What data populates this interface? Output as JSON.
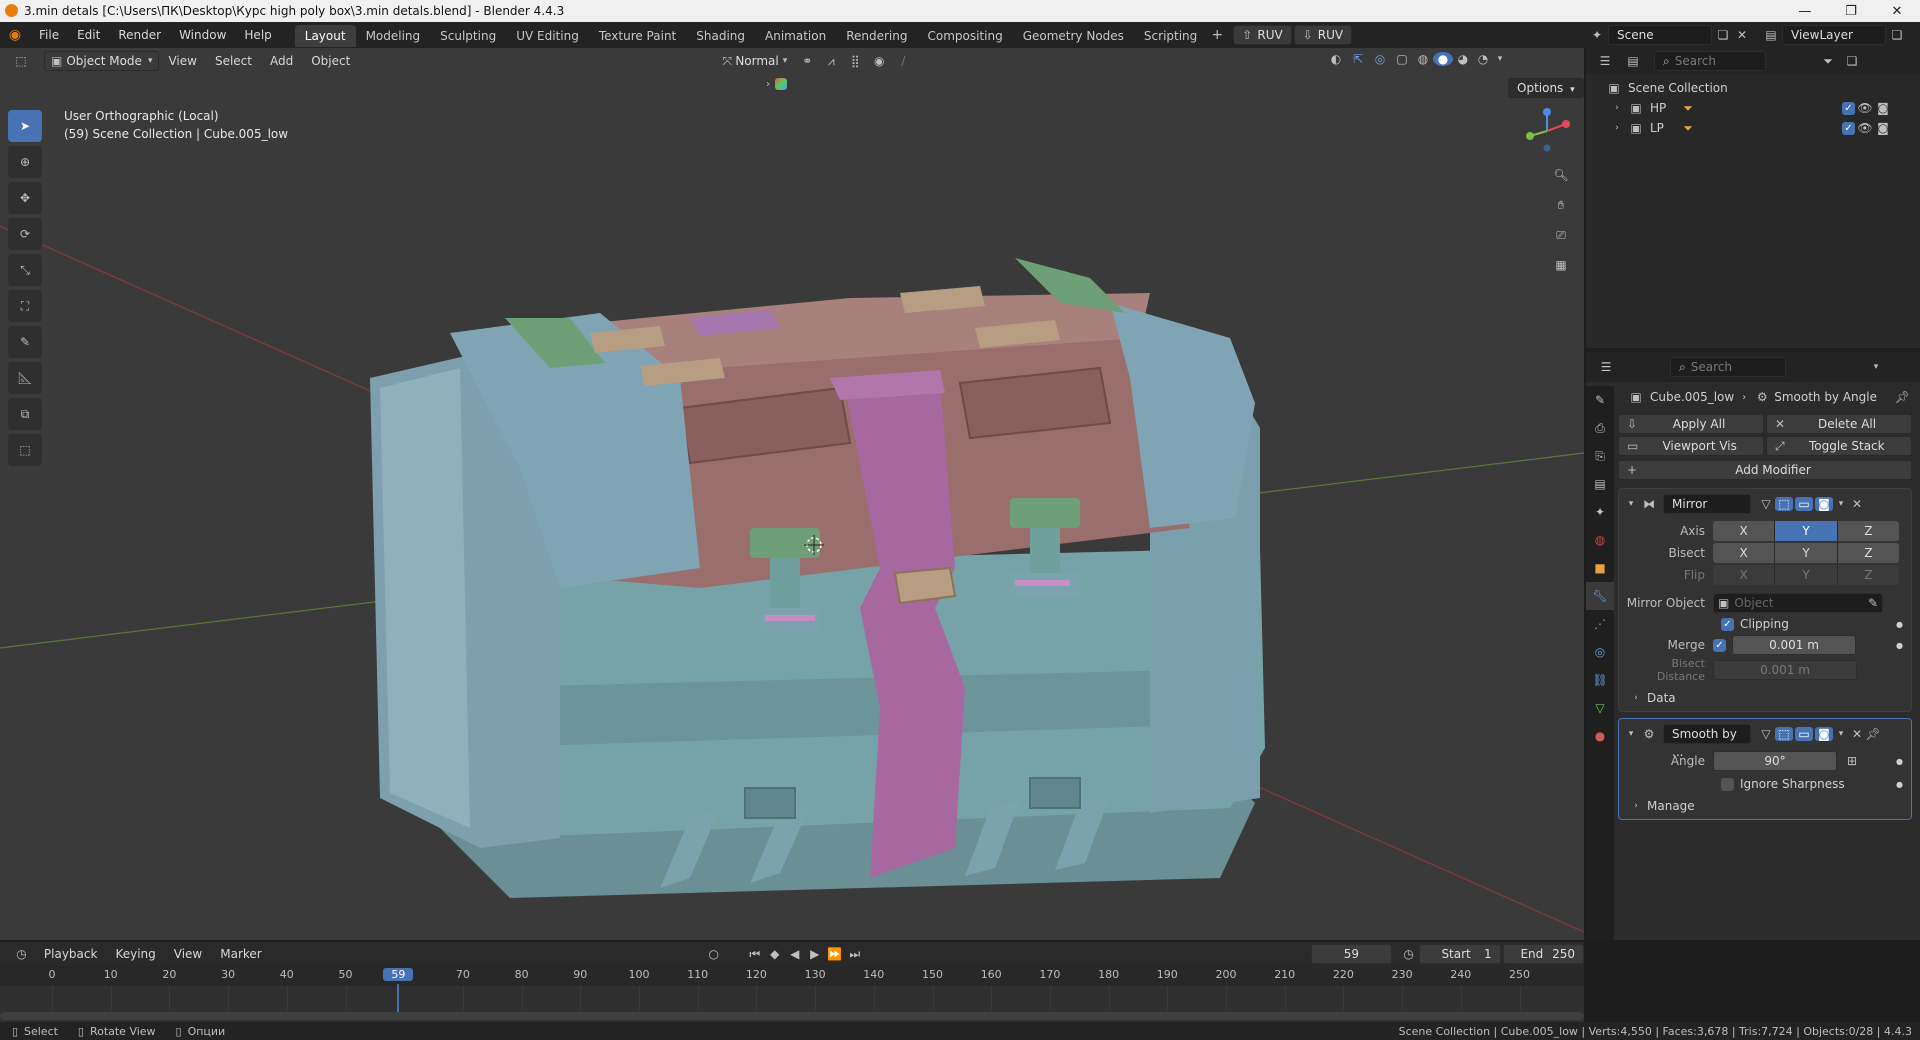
{
  "window": {
    "title": "3.min detals [C:\\Users\\ПК\\Desktop\\Курс high poly box\\3.min detals.blend] - Blender 4.4.3"
  },
  "menu": [
    "File",
    "Edit",
    "Render",
    "Window",
    "Help"
  ],
  "workspaces": [
    "Layout",
    "Modeling",
    "Sculpting",
    "UV Editing",
    "Texture Paint",
    "Shading",
    "Animation",
    "Rendering",
    "Compositing",
    "Geometry Nodes",
    "Scripting"
  ],
  "topright": {
    "ruv1": "RUV",
    "ruv2": "RUV",
    "scene": "Scene",
    "viewlayer": "ViewLayer"
  },
  "viewport": {
    "mode": "Object Mode",
    "menus": [
      "View",
      "Select",
      "Add",
      "Object"
    ],
    "orientation": "Normal",
    "options": "Options",
    "info_line1": "User Orthographic (Local)",
    "info_line2": "(59) Scene Collection | Cube.005_low"
  },
  "outliner": {
    "search_placeholder": "Search",
    "root": "Scene Collection",
    "items": [
      "HP",
      "LP"
    ]
  },
  "properties": {
    "search_placeholder": "Search",
    "breadcrumb_object": "Cube.005_low",
    "breadcrumb_modifier": "Smooth by Angle",
    "apply_all": "Apply All",
    "delete_all": "Delete All",
    "viewport_vis": "Viewport Vis",
    "toggle_stack": "Toggle Stack",
    "add_modifier": "Add Modifier",
    "mirror": {
      "name": "Mirror",
      "axis_label": "Axis",
      "bisect_label": "Bisect",
      "flip_label": "Flip",
      "x": "X",
      "y": "Y",
      "z": "Z",
      "mirror_object_label": "Mirror Object",
      "mirror_object_placeholder": "Object",
      "clipping": "Clipping",
      "merge_label": "Merge",
      "merge_value": "0.001 m",
      "bisect_distance_label": "Bisect Distance",
      "bisect_distance_value": "0.001 m",
      "data": "Data"
    },
    "smooth": {
      "name": "Smooth by ...",
      "angle_label": "Angle",
      "angle_value": "90°",
      "ignore_sharpness": "Ignore Sharpness",
      "manage": "Manage"
    }
  },
  "timeline": {
    "menus": [
      "Playback",
      "Keying",
      "View",
      "Marker"
    ],
    "current_frame": "59",
    "start_label": "Start",
    "start_value": "1",
    "end_label": "End",
    "end_value": "250",
    "ticks": [
      "0",
      "10",
      "20",
      "30",
      "40",
      "50",
      "59",
      "70",
      "80",
      "90",
      "100",
      "110",
      "120",
      "130",
      "140",
      "150",
      "160",
      "170",
      "180",
      "190",
      "200",
      "210",
      "220",
      "230",
      "240",
      "250"
    ]
  },
  "status": {
    "select": "Select",
    "rotate": "Rotate View",
    "options": "Опции",
    "stats": "Scene Collection | Cube.005_low | Verts:4,550 | Faces:3,678 | Tris:7,724 | Objects:0/28 | 4.4.3"
  },
  "colors": {
    "accent": "#4772b3",
    "box_blue": "#7fa7b5",
    "box_teal": "#6e9c9c",
    "lid_red": "#9a6e6c",
    "strap_purple": "#a7679f",
    "handle_green": "#6f9f77",
    "tan": "#b79d82"
  }
}
